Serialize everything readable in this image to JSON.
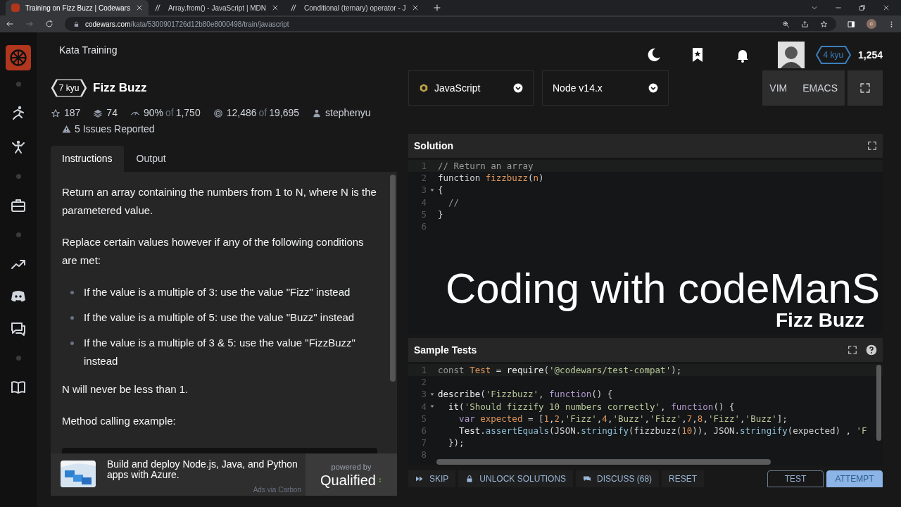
{
  "browser": {
    "tabs": [
      {
        "title": "Training on Fizz Buzz | Codewars",
        "selected": true
      },
      {
        "title": "Array.from() - JavaScript | MDN",
        "selected": false
      },
      {
        "title": "Conditional (ternary) operator - J",
        "selected": false
      }
    ],
    "url": {
      "domain": "codewars.com",
      "path": "/kata/5300901726d12b80e8000498/train/javascript"
    },
    "profile": "c"
  },
  "header": {
    "title": "Kata Training",
    "rank": "4 kyu",
    "honor": "1,254"
  },
  "kata": {
    "rank": "7 kyu",
    "title": "Fizz Buzz",
    "stats": [
      {
        "kind": "stars",
        "text": "187"
      },
      {
        "kind": "collections",
        "text": "74"
      },
      {
        "kind": "satisfaction",
        "text": "90%",
        "of": "of",
        "total": "1,750"
      },
      {
        "kind": "completed",
        "text": "12,486",
        "of": "of",
        "total": "19,695"
      },
      {
        "kind": "author",
        "text": "stephenyu"
      }
    ],
    "issues": "5 Issues Reported"
  },
  "tabs": [
    {
      "label": "Instructions",
      "selected": true
    },
    {
      "label": "Output",
      "selected": false
    }
  ],
  "instructions": [
    {
      "kind": "p",
      "text": "Return an array containing the numbers from 1 to N, where N is the parametered value."
    },
    {
      "kind": "p",
      "text": "Replace certain values however if any of the following conditions are met:"
    },
    {
      "kind": "list",
      "items": [
        "If the value is a multiple of 3: use the value \"Fizz\" instead",
        "If the value is a multiple of 5: use the value \"Buzz\" instead",
        "If the value is a multiple of 3 & 5: use the value \"FizzBuzz\" instead"
      ]
    },
    {
      "kind": "p",
      "text": "N will never be less than 1."
    },
    {
      "kind": "p",
      "text": "Method calling example:"
    }
  ],
  "ad": {
    "text": "Build and deploy Node.js, Java, and Python apps with Azure.",
    "via": "Ads via Carbon",
    "powered_by": "powered by",
    "brand": "Qualified"
  },
  "language": "JavaScript",
  "runtime": "Node v14.x",
  "modes": [
    {
      "label": "VIM"
    },
    {
      "label": "EMACS"
    }
  ],
  "solution": {
    "title": "Solution",
    "lines": [
      {
        "n": "1",
        "fold": false,
        "tokens": [
          {
            "kind": "c",
            "t": "// Return an array"
          }
        ]
      },
      {
        "n": "2",
        "fold": false,
        "tokens": [
          {
            "kind": "p",
            "t": "function "
          },
          {
            "kind": "o",
            "t": "fizzbuzz"
          },
          {
            "kind": "p",
            "t": "("
          },
          {
            "kind": "o",
            "t": "n"
          },
          {
            "kind": "p",
            "t": ")"
          }
        ]
      },
      {
        "n": "3",
        "fold": true,
        "tokens": [
          {
            "kind": "p",
            "t": "{"
          }
        ]
      },
      {
        "n": "4",
        "fold": false,
        "tokens": [
          {
            "kind": "c",
            "t": "  //"
          }
        ]
      },
      {
        "n": "5",
        "fold": false,
        "tokens": [
          {
            "kind": "p",
            "t": "}"
          }
        ]
      },
      {
        "n": "6",
        "fold": false
      }
    ]
  },
  "overlay": {
    "title": "Coding with codeManS",
    "subtitle": "Fizz Buzz"
  },
  "tests": {
    "title": "Sample Tests",
    "lines": [
      {
        "n": "1",
        "fold": false,
        "tokens": [
          {
            "kind": "c",
            "t": "const "
          },
          {
            "kind": "o",
            "t": "Test"
          },
          {
            "kind": "p",
            "t": " = "
          },
          {
            "kind": "w",
            "t": "require"
          },
          {
            "kind": "p",
            "t": "("
          },
          {
            "kind": "s",
            "t": "'@codewars/test-compat'"
          },
          {
            "kind": "p",
            "t": ");"
          }
        ]
      },
      {
        "n": "2",
        "fold": false
      },
      {
        "n": "3",
        "fold": true,
        "tokens": [
          {
            "kind": "w",
            "t": "describe"
          },
          {
            "kind": "p",
            "t": "("
          },
          {
            "kind": "s",
            "t": "'Fizzbuzz'"
          },
          {
            "kind": "p",
            "t": ", "
          },
          {
            "kind": "f",
            "t": "function"
          },
          {
            "kind": "p",
            "t": "() {"
          }
        ]
      },
      {
        "n": "4",
        "fold": true,
        "tokens": [
          {
            "kind": "w",
            "t": "  it"
          },
          {
            "kind": "p",
            "t": "("
          },
          {
            "kind": "s",
            "t": "'Should fizzify 10 numbers correctly'"
          },
          {
            "kind": "p",
            "t": ", "
          },
          {
            "kind": "f",
            "t": "function"
          },
          {
            "kind": "p",
            "t": "() {"
          }
        ]
      },
      {
        "n": "5",
        "fold": false,
        "tokens": [
          {
            "kind": "f",
            "t": "    var "
          },
          {
            "kind": "o",
            "t": "expected"
          },
          {
            "kind": "p",
            "t": " = ["
          },
          {
            "kind": "o",
            "t": "1"
          },
          {
            "kind": "p",
            "t": ","
          },
          {
            "kind": "o",
            "t": "2"
          },
          {
            "kind": "p",
            "t": ","
          },
          {
            "kind": "s",
            "t": "'Fizz'"
          },
          {
            "kind": "p",
            "t": ","
          },
          {
            "kind": "o",
            "t": "4"
          },
          {
            "kind": "p",
            "t": ","
          },
          {
            "kind": "s",
            "t": "'Buzz'"
          },
          {
            "kind": "p",
            "t": ","
          },
          {
            "kind": "s",
            "t": "'Fizz'"
          },
          {
            "kind": "p",
            "t": ","
          },
          {
            "kind": "o",
            "t": "7"
          },
          {
            "kind": "p",
            "t": ","
          },
          {
            "kind": "o",
            "t": "8"
          },
          {
            "kind": "p",
            "t": ","
          },
          {
            "kind": "s",
            "t": "'Fizz'"
          },
          {
            "kind": "p",
            "t": ","
          },
          {
            "kind": "s",
            "t": "'Buzz'"
          },
          {
            "kind": "p",
            "t": "];"
          }
        ]
      },
      {
        "n": "6",
        "fold": false,
        "tokens": [
          {
            "kind": "w",
            "t": "    Test"
          },
          {
            "kind": "p",
            "t": "."
          },
          {
            "kind": "m",
            "t": "assertEquals"
          },
          {
            "kind": "p",
            "t": "(JSON."
          },
          {
            "kind": "m",
            "t": "stringify"
          },
          {
            "kind": "p",
            "t": "(fizzbuzz("
          },
          {
            "kind": "o",
            "t": "10"
          },
          {
            "kind": "p",
            "t": ")), JSON."
          },
          {
            "kind": "m",
            "t": "stringify"
          },
          {
            "kind": "p",
            "t": "(expected) , "
          },
          {
            "kind": "s",
            "t": "'F"
          }
        ]
      },
      {
        "n": "7",
        "fold": false,
        "tokens": [
          {
            "kind": "p",
            "t": "  });"
          }
        ]
      },
      {
        "n": "8",
        "fold": false
      }
    ]
  },
  "actions": [
    {
      "kind": "skip",
      "label": "SKIP"
    },
    {
      "kind": "unlock",
      "label": "UNLOCK SOLUTIONS"
    },
    {
      "kind": "discuss",
      "label": "DISCUSS (68)"
    },
    {
      "kind": "reset",
      "label": "RESET"
    }
  ],
  "buttons": [
    {
      "kind": "outline",
      "label": "TEST"
    },
    {
      "kind": "primary",
      "label": "ATTEMPT"
    }
  ]
}
